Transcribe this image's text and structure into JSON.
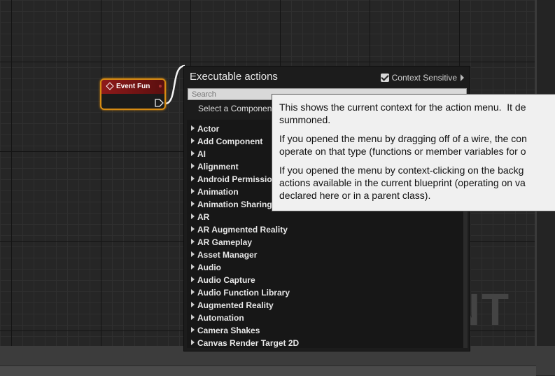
{
  "node": {
    "title": "Event Fun"
  },
  "menu": {
    "title": "Executable actions",
    "context_sensitive_label": "Context Sensitive",
    "context_sensitive_checked": true,
    "search_placeholder": "Search",
    "select_component_label": "Select a Componen",
    "categories": [
      "Actor",
      "Add Component",
      "AI",
      "Alignment",
      "Android Permission",
      "Animation",
      "Animation Sharing",
      "AR",
      "AR Augmented Reality",
      "AR Gameplay",
      "Asset Manager",
      "Audio",
      "Audio Capture",
      "Audio Function Library",
      "Augmented Reality",
      "Automation",
      "Camera Shakes",
      "Canvas Render Target 2D"
    ]
  },
  "tooltip": {
    "p1": "This shows the current context for the action menu.  It de\nsummoned.",
    "p2": "If you opened the menu by dragging off of a wire, the con\noperate on that type (functions or member variables for o",
    "p3": "If you opened the menu by context-clicking on the backg\nactions available in the current blueprint (operating on va\ndeclared here or in a parent class)."
  },
  "watermark": "INT",
  "colors": {
    "node_border": "#d68b13",
    "event_header": "#8e1a1a",
    "tooltip_bg": "#f0f0f0"
  }
}
